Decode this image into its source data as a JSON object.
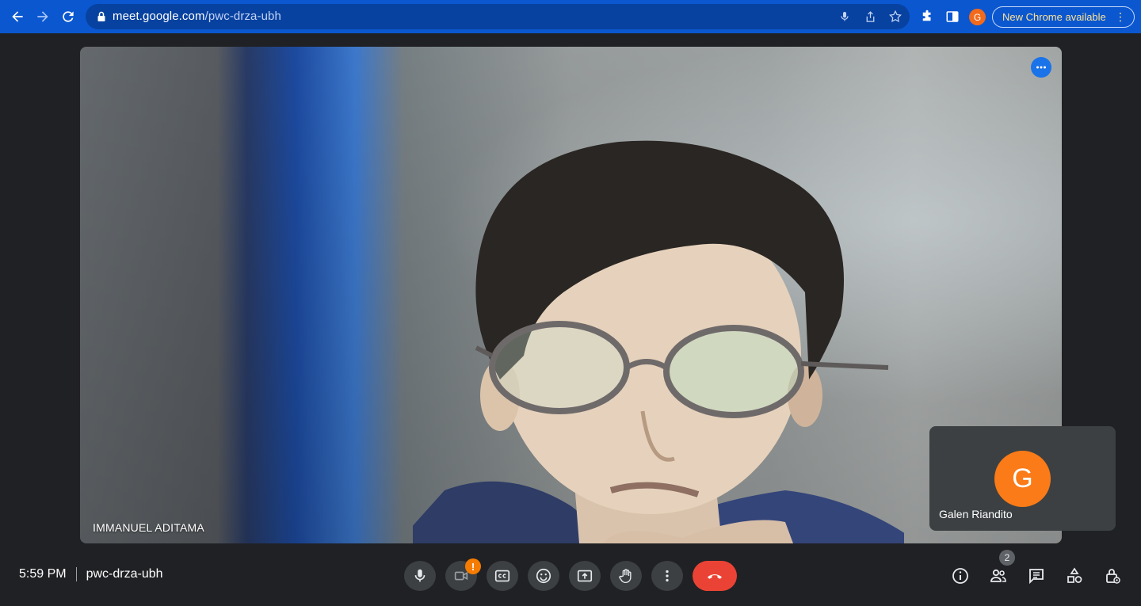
{
  "browser": {
    "url_host": "meet.google.com",
    "url_path": "/pwc-drza-ubh",
    "profile_initial": "G",
    "update_label": "New Chrome available",
    "update_menu": "⋮"
  },
  "stage": {
    "participant_name": "IMMANUEL ADITAMA"
  },
  "self_tile": {
    "avatar_initial": "G",
    "name": "Galen Riandito"
  },
  "bottom_bar": {
    "time": "5:59 PM",
    "meeting_code": "pwc-drza-ubh",
    "camera_warning": "!",
    "participant_count": "2"
  },
  "colors": {
    "browser_bar": "#0b57d0",
    "end_call": "#ea4335",
    "self_avatar": "#fa7b17",
    "tile_more": "#1a73e8"
  }
}
